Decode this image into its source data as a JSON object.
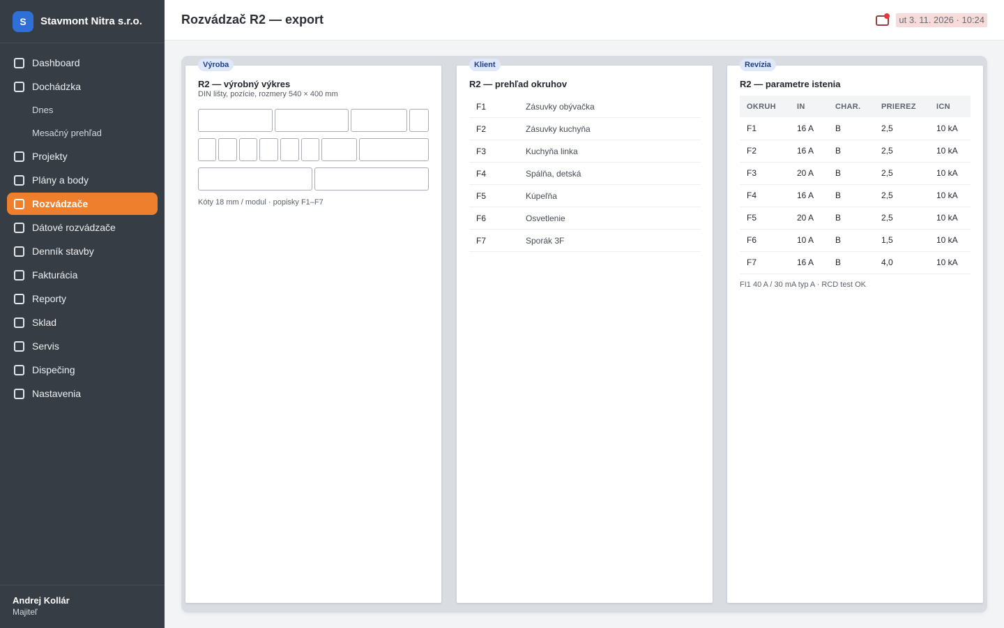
{
  "brand": {
    "logo_letter": "S",
    "name": "Stavmont Nitra s.r.o."
  },
  "sidebar": {
    "items": [
      {
        "label": "Dashboard"
      },
      {
        "label": "Dochádzka"
      },
      {
        "label": "Dnes",
        "sub": true
      },
      {
        "label": "Mesačný prehľad",
        "sub": true
      },
      {
        "label": "Projekty"
      },
      {
        "label": "Plány a body"
      },
      {
        "label": "Rozvádzače",
        "active": true
      },
      {
        "label": "Dátové rozvádzače"
      },
      {
        "label": "Denník stavby"
      },
      {
        "label": "Fakturácia"
      },
      {
        "label": "Reporty"
      },
      {
        "label": "Sklad"
      },
      {
        "label": "Servis"
      },
      {
        "label": "Dispečing"
      },
      {
        "label": "Nastavenia"
      }
    ],
    "user": {
      "name": "Andrej Kollár",
      "role": "Majiteľ"
    }
  },
  "header": {
    "title": "Rozvádzač R2 — export",
    "datetime": "ut 3. 11. 2026 · 10:24"
  },
  "colors": {
    "accent": "#ee7f2d",
    "sidebar_bg": "#373d44",
    "brand_blue": "#2f6fd6",
    "tag_bg": "#dfe8fa",
    "notification": "#e5383b"
  },
  "panels": {
    "production": {
      "tag": "Výroba",
      "title": "R2 — výrobný výkres",
      "subtitle": "DIN lišty, pozície, rozmery 540 × 400 mm",
      "note": "Kóty 18 mm / modul · popisky F1–F7"
    },
    "client": {
      "tag": "Klient",
      "title": "R2 — prehľad okruhov",
      "circuits": [
        {
          "id": "F1",
          "name": "Zásuvky obývačka"
        },
        {
          "id": "F2",
          "name": "Zásuvky kuchyňa"
        },
        {
          "id": "F3",
          "name": "Kuchyňa linka"
        },
        {
          "id": "F4",
          "name": "Spálňa, detská"
        },
        {
          "id": "F5",
          "name": "Kúpeľňa"
        },
        {
          "id": "F6",
          "name": "Osvetlenie"
        },
        {
          "id": "F7",
          "name": "Sporák 3F"
        }
      ]
    },
    "revision": {
      "tag": "Revízia",
      "title": "R2 — parametre istenia",
      "columns": [
        "OKRUH",
        "IN",
        "CHAR.",
        "PRIEREZ",
        "ICN"
      ],
      "rows": [
        [
          "F1",
          "16 A",
          "B",
          "2,5",
          "10 kA"
        ],
        [
          "F2",
          "16 A",
          "B",
          "2,5",
          "10 kA"
        ],
        [
          "F3",
          "20 A",
          "B",
          "2,5",
          "10 kA"
        ],
        [
          "F4",
          "16 A",
          "B",
          "2,5",
          "10 kA"
        ],
        [
          "F5",
          "20 A",
          "B",
          "2,5",
          "10 kA"
        ],
        [
          "F6",
          "10 A",
          "B",
          "1,5",
          "10 kA"
        ],
        [
          "F7",
          "16 A",
          "B",
          "4,0",
          "10 kA"
        ]
      ],
      "note": "FI1 40 A / 30 mA typ A · RCD test OK"
    }
  }
}
